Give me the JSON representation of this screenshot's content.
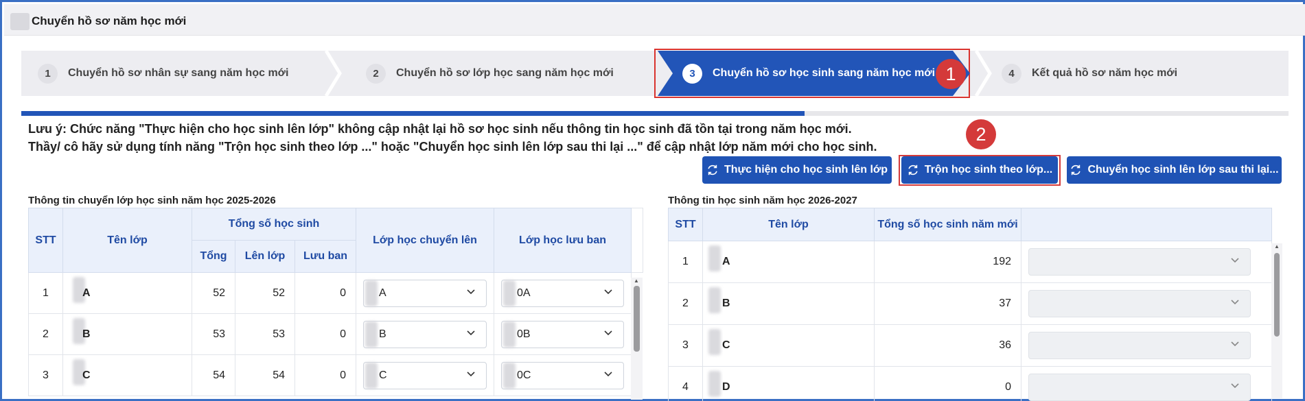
{
  "window": {
    "title": "Chuyển hồ sơ năm học mới"
  },
  "steps": [
    {
      "num": "1",
      "label": "Chuyển hồ sơ nhân sự sang năm học mới",
      "active": false
    },
    {
      "num": "2",
      "label": "Chuyển hồ sơ lớp học sang năm học mới",
      "active": false
    },
    {
      "num": "3",
      "label": "Chuyển hồ sơ học sinh sang năm học mới",
      "active": true
    },
    {
      "num": "4",
      "label": "Kết quả hồ sơ năm học mới",
      "active": false
    }
  ],
  "markers": {
    "m1": "1",
    "m2": "2"
  },
  "progress": {
    "fraction": 0.618
  },
  "notes": {
    "line1": "Lưu ý: Chức năng \"Thực hiện cho học sinh lên lớp\" không cập nhật lại hồ sơ học sinh nếu thông tin học sinh đã tồn tại trong năm học mới.",
    "line2": "Thầy/ cô hãy sử dụng tính năng \"Trộn học sinh theo lớp ...\" hoặc \"Chuyển học sinh lên lớp sau thi lại ...\" để cập nhật lớp năm mới cho học sinh."
  },
  "buttons": {
    "promote": "Thực hiện cho học sinh lên lớp",
    "merge": "Trộn học sinh theo lớp...",
    "retake": "Chuyển học sinh lên lớp sau thi lại..."
  },
  "left_table": {
    "title": "Thông tin chuyển lớp học sinh năm học 2025-2026",
    "headers": {
      "stt": "STT",
      "class": "Tên lớp",
      "total_group": "Tổng số học sinh",
      "total": "Tổng",
      "promoted": "Lên lớp",
      "retained": "Lưu ban",
      "to_class": "Lớp học chuyển lên",
      "retained_class": "Lớp học lưu ban"
    },
    "rows": [
      {
        "stt": "1",
        "class": "A",
        "total": "52",
        "promoted": "52",
        "retained": "0",
        "to_class": "A",
        "retained_class": "0A"
      },
      {
        "stt": "2",
        "class": "B",
        "total": "53",
        "promoted": "53",
        "retained": "0",
        "to_class": "B",
        "retained_class": "0B"
      },
      {
        "stt": "3",
        "class": "C",
        "total": "54",
        "promoted": "54",
        "retained": "0",
        "to_class": "C",
        "retained_class": "0C"
      }
    ]
  },
  "right_table": {
    "title": "Thông tin học sinh năm học 2026-2027",
    "headers": {
      "stt": "STT",
      "class": "Tên lớp",
      "total_new": "Tổng số học sinh năm mới"
    },
    "rows": [
      {
        "stt": "1",
        "class": "A",
        "total_new": "192"
      },
      {
        "stt": "2",
        "class": "B",
        "total_new": "37"
      },
      {
        "stt": "3",
        "class": "C",
        "total_new": "36"
      },
      {
        "stt": "4",
        "class": "D",
        "total_new": "0"
      }
    ]
  },
  "colors": {
    "primary": "#1f53b5",
    "active_step": "#2255b8",
    "annotation": "#d43a3a",
    "header_bg": "#eaf0fb"
  }
}
